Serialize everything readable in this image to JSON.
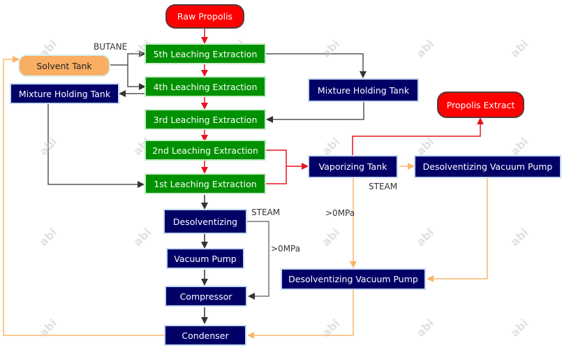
{
  "nodes": {
    "raw_propolis": "Raw Propolis",
    "leach5": "5th Leaching Extraction",
    "leach4": "4th Leaching Extraction",
    "leach3": "3rd Leaching Extraction",
    "leach2": "2nd Leaching Extraction",
    "leach1": "1st Leaching Extraction",
    "solvent_tank": "Solvent Tank",
    "mixture_tank_left": "Mixture Holding Tank",
    "mixture_tank_right": "Mixture Holding Tank",
    "propolis_extract": "Propolis Extract",
    "vaporizing_tank": "Vaporizing Tank",
    "desolv_vac_pump_right": "Desolventizing Vacuum Pump",
    "desolventizing": "Desolventizing",
    "vacuum_pump": "Vacuum Pump",
    "compressor": "Compressor",
    "condenser": "Condenser",
    "desolv_vac_pump_mid": "Desolventizing Vacuum Pump"
  },
  "labels": {
    "butane": "BUTANE",
    "steam_left": "STEAM",
    "steam_right": "STEAM",
    "pressure_left": ">0MPa",
    "pressure_mid": ">0MPa"
  },
  "watermark": "abi",
  "colors": {
    "extraction_green": "#009100",
    "equipment_navy": "#000066",
    "endpoint_red": "#ff0000",
    "solvent_orange": "#f9ae63",
    "flow_red": "#e8141e",
    "flow_gray": "#555555",
    "flow_orange": "#f9b56e"
  }
}
